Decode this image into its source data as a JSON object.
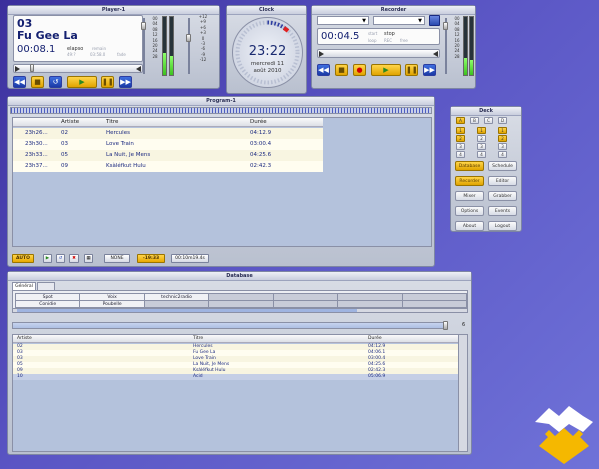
{
  "player": {
    "title": "Player-1",
    "track_no": "03",
    "track_name": "Fu Gee La",
    "time": "00:08.1",
    "elapsed_label": "elapso",
    "elapsed_value": "49:?",
    "remain_label": "remain",
    "remain_value": "03:58.0",
    "fade_label": "fade",
    "vu_scale": [
      "00",
      "04",
      "08",
      "12",
      "16",
      "20",
      "24",
      "28"
    ],
    "pitch_scale": [
      "+12",
      "+9",
      "+6",
      "+3",
      "0",
      "-3",
      "-6",
      "-9",
      "-12"
    ]
  },
  "clock": {
    "title": "Clock",
    "time": "23:22",
    "day": "mercredi 11",
    "month": "août 2010"
  },
  "recorder": {
    "title": "Recorder",
    "time": "00:04.5",
    "start_label": "start",
    "stop_label": "stop",
    "loop_label": "loop",
    "rec_label": "REC",
    "free_label": "free",
    "vu_scale": [
      "00",
      "04",
      "08",
      "12",
      "16",
      "20",
      "24",
      "28"
    ]
  },
  "program": {
    "title": "Program-1",
    "columns": [
      "Artiste",
      "Titre",
      "Durée"
    ],
    "rows": [
      {
        "time": "23h26...",
        "artist": "02",
        "title": "Hercules",
        "duration": "04:12.9"
      },
      {
        "time": "23h30...",
        "artist": "03",
        "title": "Love Train",
        "duration": "03:00.4"
      },
      {
        "time": "23h33...",
        "artist": "05",
        "title": "La Nuit, Je Mens",
        "duration": "04:25.6"
      },
      {
        "time": "23h37...",
        "artist": "09",
        "title": "Ksàléfkut Hulu",
        "duration": "02:42.3"
      }
    ],
    "auto_label": "AUTO",
    "none_label": "NONE",
    "clock_value": "-19:33",
    "total_value": "00:10m19.4s"
  },
  "deck": {
    "title": "Deck",
    "top_row": [
      "A",
      "B",
      "C",
      "D"
    ],
    "grid": [
      [
        "1",
        "1",
        "1"
      ],
      [
        "2",
        "2",
        "2"
      ],
      [
        "3",
        "3",
        "3"
      ],
      [
        "4",
        "4",
        "4"
      ]
    ],
    "buttons": [
      [
        "Database",
        "Schedule"
      ],
      [
        "Recorder",
        "Editor"
      ],
      [
        "Mixer",
        "Grabber"
      ],
      [
        "Options",
        "Events"
      ],
      [
        "About",
        "Logout"
      ]
    ]
  },
  "database": {
    "title": "Database",
    "tab": "Général",
    "categories_row1": [
      "Spot",
      "Voix",
      "technic2radio",
      "",
      "",
      "",
      ""
    ],
    "categories_row2": [
      "Conidie",
      "Poubelle",
      "",
      "",
      "",
      "",
      ""
    ],
    "count": "6",
    "columns": [
      "Artiste",
      "Titre",
      "Durée"
    ],
    "rows": [
      {
        "artist": "02",
        "title": "Hercules",
        "duration": "04:12.9"
      },
      {
        "artist": "03",
        "title": "Fu Gee La",
        "duration": "04:06.1"
      },
      {
        "artist": "03",
        "title": "Love Train",
        "duration": "03:00.4"
      },
      {
        "artist": "05",
        "title": "La Nuit, Je Mens",
        "duration": "04:25.6"
      },
      {
        "artist": "09",
        "title": "Ksàléfkut Hulu",
        "duration": "02:42.3"
      },
      {
        "artist": "10",
        "title": "Acid",
        "duration": "05:06.9",
        "selected": true
      }
    ]
  },
  "colors": {
    "accent": "#f2b300",
    "transport_blue": "#1a3aa6",
    "background": "#4d47b8"
  }
}
